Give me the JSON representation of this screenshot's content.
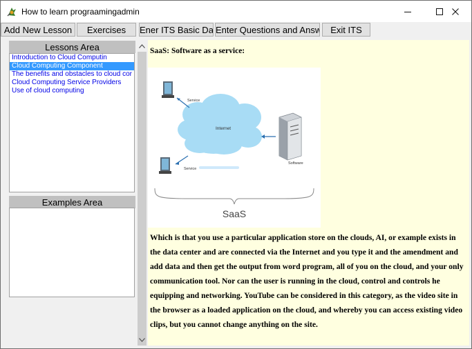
{
  "window": {
    "title": "How to learn prograamingadmin",
    "minimize_glyph": "–",
    "maximize_glyph": "☐",
    "close_glyph": "✕"
  },
  "toolbar": {
    "buttons": [
      {
        "label": "Add New Lesson"
      },
      {
        "label": "Exercises"
      },
      {
        "label": "Ener ITS Basic Data"
      },
      {
        "label": "Enter Questions and Answers"
      },
      {
        "label": "Exit ITS"
      }
    ]
  },
  "lessons": {
    "header": "Lessons Area",
    "items": [
      {
        "label": "Introduction to Cloud Computin",
        "selected": false
      },
      {
        "label": "Cloud Computing Component",
        "selected": true
      },
      {
        "label": "The benefits and obstacles to cloud cor",
        "selected": false
      },
      {
        "label": "Cloud Computing Service Providers",
        "selected": false
      },
      {
        "label": "Use of cloud computing",
        "selected": false
      }
    ]
  },
  "examples": {
    "header": "Examples Area"
  },
  "content": {
    "title": "SaaS: Software as a service:",
    "diagram": {
      "label_service_top": "Service",
      "label_service_bottom": "Service",
      "label_internet": "Internet",
      "label_software": "Software",
      "caption": "SaaS"
    },
    "body": "Which is that you use a particular application store on the clouds, AI, or example exists in the data center and are connected via the Internet and you type it and the amendment and add data and then get the output from word program, all of you on the cloud, and your only communication tool. Nor can the user is running in the cloud, control and controls he equipping and networking. YouTube can be considered in this category, as the video site in the browser as a loaded application on the cloud, and whereby you can access existing video clips, but you cannot change anything on the site."
  },
  "colors": {
    "selection": "#3399ff",
    "link_text": "#0000e6",
    "content_bg": "#ffffe0",
    "panel_header": "#c0c0c0"
  },
  "icons": {
    "app": "app-icon",
    "scroll_up": "scroll-up-icon",
    "scroll_down": "scroll-down-icon"
  }
}
